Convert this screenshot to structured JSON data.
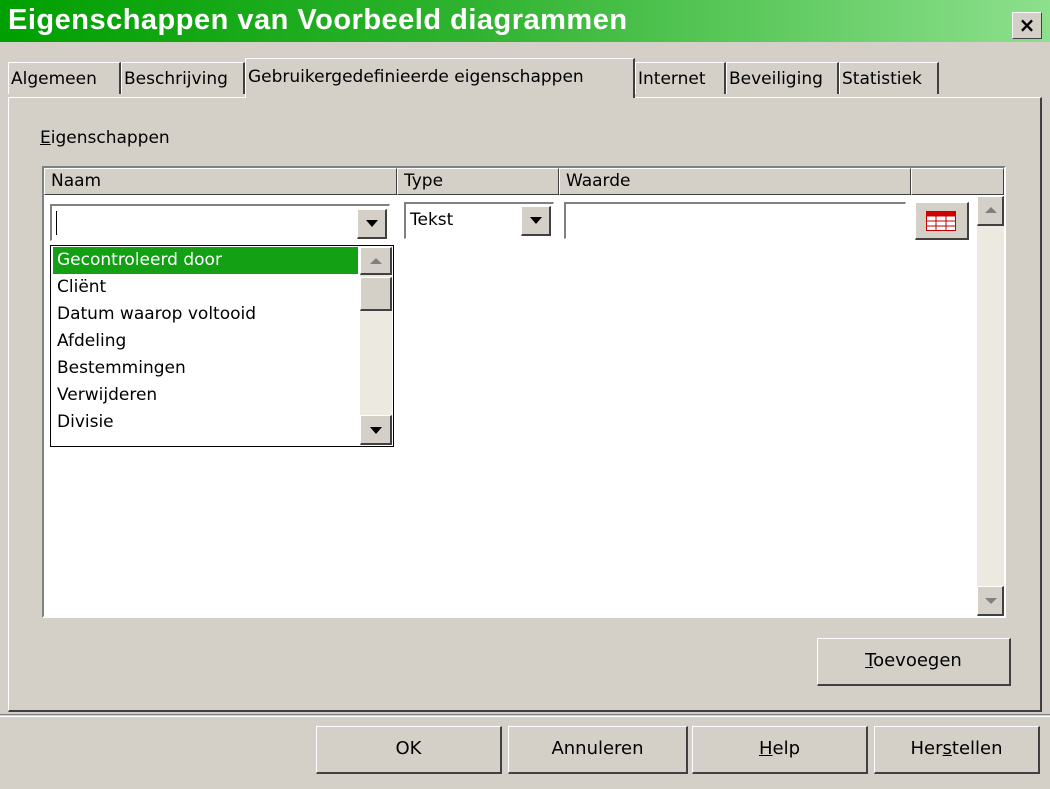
{
  "window": {
    "title": "Eigenschappen van Voorbeeld diagrammen",
    "close_glyph": "×"
  },
  "tabs": [
    {
      "label": "Algemeen"
    },
    {
      "label": "Beschrijving"
    },
    {
      "label": "Gebruikergedefinieerde eigenschappen",
      "active": true
    },
    {
      "label": "Internet"
    },
    {
      "label": "Beveiliging"
    },
    {
      "label": "Statistiek"
    }
  ],
  "properties": {
    "group_label_mnemonic": "E",
    "group_label_rest": "igenschappen",
    "columns": {
      "name": "Naam",
      "type": "Type",
      "value": "Waarde"
    },
    "row": {
      "name_value": "",
      "type_value": "Tekst",
      "value_value": ""
    },
    "name_dropdown": {
      "items": [
        "Gecontroleerd door",
        "Cliënt",
        "Datum waarop voltooid",
        "Afdeling",
        "Bestemmingen",
        "Verwijderen",
        "Divisie"
      ],
      "selected_index": 0
    }
  },
  "buttons": {
    "add": {
      "mnemonic": "T",
      "rest": "oevoegen"
    },
    "ok": "OK",
    "cancel": "Annuleren",
    "help": {
      "mnemonic": "H",
      "rest": "elp"
    },
    "reset": {
      "pre": "Her",
      "mnemonic": "s",
      "rest": "tellen"
    }
  },
  "colors": {
    "accent": "#14a014",
    "title_start": "#00a000",
    "title_end": "#8de08d",
    "face": "#d4d0c8"
  }
}
